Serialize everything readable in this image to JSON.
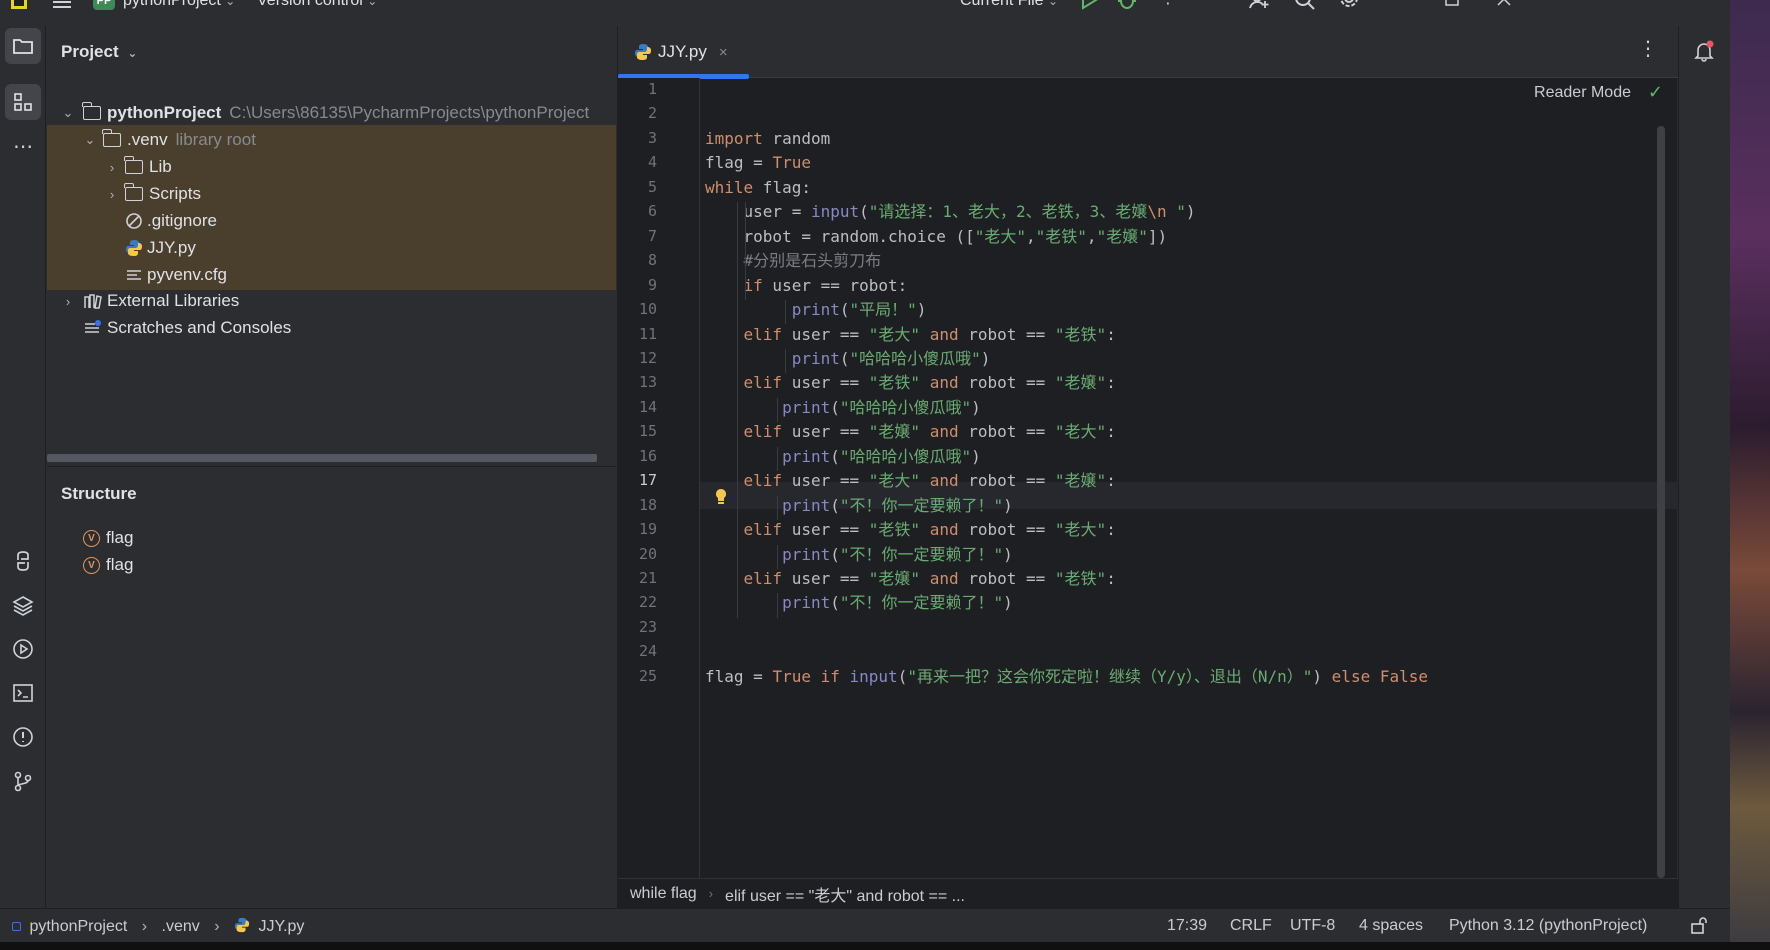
{
  "topbar": {
    "project_badge": "PP",
    "project_name": "pythonProject",
    "vcs": "Version control",
    "run_config": "Current File"
  },
  "project_panel": {
    "title": "Project",
    "tree": [
      {
        "label": "pythonProject",
        "hint": "C:\\Users\\86135\\PycharmProjects\\pythonProject",
        "type": "folder",
        "expanded": true
      },
      {
        "label": ".venv",
        "hint": "library root",
        "type": "folder",
        "expanded": true
      },
      {
        "label": "Lib",
        "type": "folder"
      },
      {
        "label": "Scripts",
        "type": "folder"
      },
      {
        "label": ".gitignore",
        "type": "ignore-file"
      },
      {
        "label": "JJY.py",
        "type": "python-file"
      },
      {
        "label": "pyvenv.cfg",
        "type": "config-file"
      },
      {
        "label": "External Libraries",
        "type": "library"
      },
      {
        "label": "Scratches and Consoles",
        "type": "scratches"
      }
    ]
  },
  "structure": {
    "title": "Structure",
    "items": [
      {
        "badge": "V",
        "label": "flag"
      },
      {
        "badge": "V",
        "label": "flag"
      }
    ]
  },
  "editor": {
    "tab_label": "JJY.py",
    "tab_close": "×",
    "reader_mode": "Reader Mode",
    "current_line": 17,
    "line_numbers": [
      "1",
      "2",
      "3",
      "4",
      "5",
      "6",
      "7",
      "8",
      "9",
      "10",
      "11",
      "12",
      "13",
      "14",
      "15",
      "16",
      "17",
      "18",
      "19",
      "20",
      "21",
      "22",
      "23",
      "24",
      "25"
    ],
    "code": {
      "l3": [
        "import",
        " random"
      ],
      "l4": [
        "flag = ",
        "True"
      ],
      "l5": [
        "while",
        " flag:"
      ],
      "l6": [
        "    user = ",
        "input",
        "(",
        "\"请选择：1、老大，2、老铁，3、老嬢",
        "\\n",
        " \"",
        ")"
      ],
      "l7": [
        "    robot = random.choice ([",
        "\"老大\"",
        ",",
        "\"老铁\"",
        ",",
        "\"老嬢\"",
        "])"
      ],
      "l8": [
        "    #分别是石头剪刀布"
      ],
      "l9": [
        "    ",
        "if",
        " user == robot:"
      ],
      "l10": [
        "         ",
        "print",
        "(",
        "\"平局！\"",
        ")"
      ],
      "l11": [
        "    ",
        "elif",
        " user == ",
        "\"老大\"",
        " ",
        "and",
        " robot == ",
        "\"老铁\"",
        ":"
      ],
      "l12": [
        "         ",
        "print",
        "(",
        "\"哈哈哈小傻瓜哦\"",
        ")"
      ],
      "l13": [
        "    ",
        "elif",
        " user == ",
        "\"老铁\"",
        " ",
        "and",
        " robot == ",
        "\"老嬢\"",
        ":"
      ],
      "l14": [
        "        ",
        "print",
        "(",
        "\"哈哈哈小傻瓜哦\"",
        ")"
      ],
      "l15": [
        "    ",
        "elif",
        " user == ",
        "\"老嬢\"",
        " ",
        "and",
        " robot == ",
        "\"老大\"",
        ":"
      ],
      "l16": [
        "        ",
        "print",
        "(",
        "\"哈哈哈小傻瓜哦\"",
        ")"
      ],
      "l17": [
        "    ",
        "elif",
        " user == ",
        "\"老大\"",
        " ",
        "and",
        " robot == ",
        "\"老嬢\"",
        ":"
      ],
      "l18": [
        "        ",
        "print",
        "(",
        "\"不！你一定要赖了！\"",
        ")"
      ],
      "l19": [
        "    ",
        "elif",
        " user == ",
        "\"老铁\"",
        " ",
        "and",
        " robot == ",
        "\"老大\"",
        ":"
      ],
      "l20": [
        "        ",
        "print",
        "(",
        "\"不！你一定要赖了！\"",
        ")"
      ],
      "l21": [
        "    ",
        "elif",
        " user == ",
        "\"老嬢\"",
        " ",
        "and",
        " robot == ",
        "\"老铁\"",
        ":"
      ],
      "l22": [
        "        ",
        "print",
        "(",
        "\"不！你一定要赖了！\"",
        ")"
      ],
      "l25": [
        "flag = ",
        "True",
        " ",
        "if",
        " ",
        "input",
        "(",
        "\"再来一把？这会你死定啦！继续（Y/y）、退出（N/n）\"",
        ") ",
        "else",
        " ",
        "False"
      ]
    },
    "breadcrumbs": [
      "while flag",
      "elif user == \"老大\" and robot == ..."
    ]
  },
  "statusbar": {
    "path": [
      "pythonProject",
      ".venv",
      "JJY.py"
    ],
    "position": "17:39",
    "line_sep": "CRLF",
    "encoding": "UTF-8",
    "indent": "4 spaces",
    "interpreter": "Python 3.12 (pythonProject)"
  },
  "colors": {
    "keyword": "#cf8e6d",
    "string": "#6aab73",
    "builtin": "#8888c6",
    "selection": "#4a3f2c",
    "tab_accent": "#3574f0"
  }
}
